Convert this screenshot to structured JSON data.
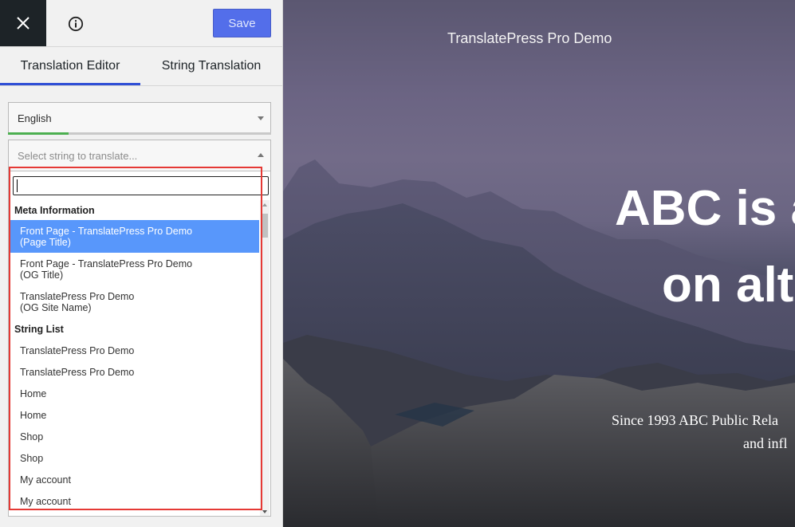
{
  "toolbar": {
    "close_icon": "close-icon",
    "info_icon": "info-icon",
    "save_label": "Save"
  },
  "tabs": [
    {
      "label": "Translation Editor",
      "active": true
    },
    {
      "label": "String Translation",
      "active": false
    }
  ],
  "language_select": {
    "value": "English",
    "progress": 0.23
  },
  "string_select": {
    "placeholder": "Select string to translate..."
  },
  "dropdown": {
    "search_value": "",
    "groups": [
      {
        "label": "Meta Information",
        "options": [
          {
            "text": "Front Page - TranslatePress Pro Demo",
            "sub": "(Page Title)",
            "selected": true
          },
          {
            "text": "Front Page - TranslatePress Pro Demo",
            "sub": "(OG Title)",
            "selected": false
          },
          {
            "text": "TranslatePress Pro Demo",
            "sub": "(OG Site Name)",
            "selected": false
          }
        ]
      },
      {
        "label": "String List",
        "options": [
          {
            "text": "TranslatePress Pro Demo"
          },
          {
            "text": "TranslatePress Pro Demo"
          },
          {
            "text": "Home"
          },
          {
            "text": "Home"
          },
          {
            "text": "Shop"
          },
          {
            "text": "Shop"
          },
          {
            "text": "My account"
          },
          {
            "text": "My account"
          }
        ]
      }
    ]
  },
  "colors": {
    "highlight": "#e53935",
    "selected_option": "#5897fb",
    "save_button": "#3858e9",
    "active_tab": "#2f4fd6"
  },
  "preview": {
    "site_title": "TranslatePress Pro Demo",
    "hero_line_1": "ABC is a",
    "hero_line_2": "on alt",
    "subtitle_line_1": "Since 1993 ABC Public Rela",
    "subtitle_line_2": "and infl"
  }
}
